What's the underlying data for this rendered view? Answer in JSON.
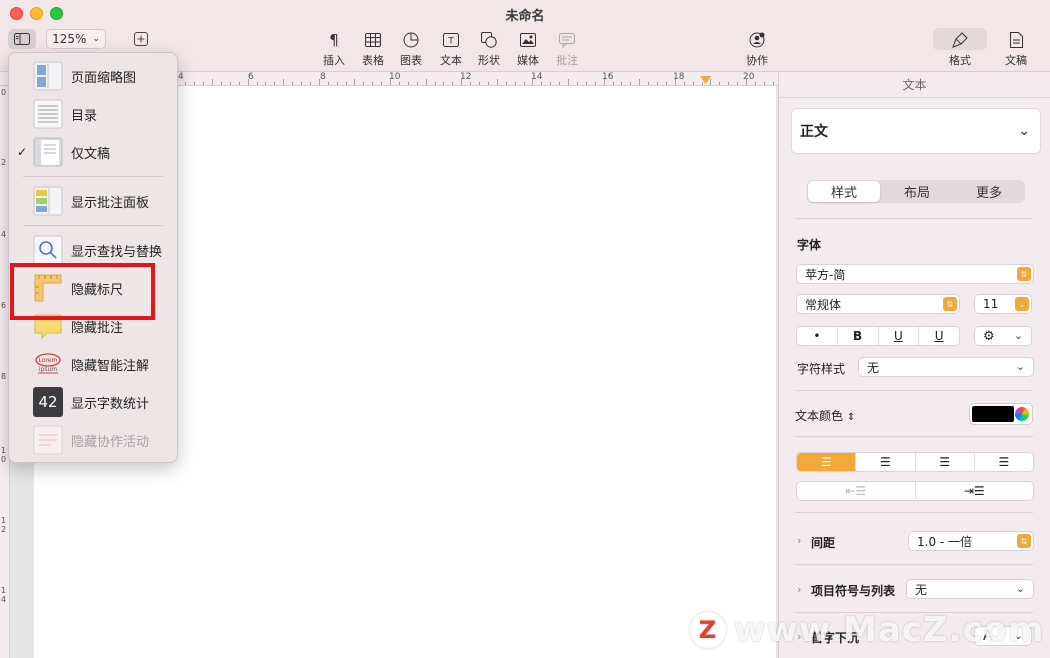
{
  "window": {
    "title": "未命名"
  },
  "toolbar": {
    "zoom": "125%",
    "tools": [
      {
        "label": "插入",
        "icon": "paragraph-icon"
      },
      {
        "label": "表格",
        "icon": "table-icon"
      },
      {
        "label": "图表",
        "icon": "chart-icon"
      },
      {
        "label": "文本",
        "icon": "textbox-icon"
      },
      {
        "label": "形状",
        "icon": "shape-icon"
      },
      {
        "label": "媒体",
        "icon": "media-icon"
      },
      {
        "label": "批注",
        "icon": "comment-icon"
      },
      {
        "label": "协作",
        "icon": "collaborate-icon"
      },
      {
        "label": "格式",
        "icon": "format-brush-icon"
      },
      {
        "label": "文稿",
        "icon": "document-icon"
      }
    ]
  },
  "ruler": {
    "numbers": [
      "4",
      "6",
      "8",
      "10",
      "12",
      "14",
      "16",
      "18",
      "20"
    ]
  },
  "vruler": {
    "numbers": [
      "0",
      "2",
      "4",
      "6",
      "8",
      "1\n0",
      "1\n2",
      "1\n4"
    ]
  },
  "menu": {
    "items": [
      {
        "label": "页面缩略图",
        "checked": false,
        "disabled": false,
        "icon": "page-thumbnails-icon"
      },
      {
        "label": "目录",
        "checked": false,
        "disabled": false,
        "icon": "table-of-contents-icon"
      },
      {
        "label": "仅文稿",
        "checked": true,
        "disabled": false,
        "icon": "document-only-icon"
      },
      {
        "label": "显示批注面板",
        "checked": false,
        "disabled": false,
        "icon": "comments-pane-icon"
      },
      {
        "label": "显示查找与替换",
        "checked": false,
        "disabled": false,
        "icon": "find-replace-icon"
      },
      {
        "label": "隐藏标尺",
        "checked": false,
        "disabled": false,
        "icon": "ruler-icon"
      },
      {
        "label": "隐藏批注",
        "checked": false,
        "disabled": false,
        "icon": "comments-icon"
      },
      {
        "label": "隐藏智能注解",
        "checked": false,
        "disabled": false,
        "icon": "smart-annotation-icon"
      },
      {
        "label": "显示字数统计",
        "checked": false,
        "disabled": false,
        "icon": "word-count-icon"
      },
      {
        "label": "隐藏协作活动",
        "checked": false,
        "disabled": true,
        "icon": "collaboration-activity-icon"
      }
    ],
    "check_mark": "✓",
    "word_count_badge": "42",
    "lorem_badge": "Lorem ipsum"
  },
  "inspector": {
    "title": "文本",
    "paragraph_style": "正文",
    "tabs": [
      "样式",
      "布局",
      "更多"
    ],
    "active_tab": "样式",
    "font_section": "字体",
    "font_family": "苹方-简",
    "font_weight": "常规体",
    "font_size": "11",
    "char_style_label": "字符样式",
    "char_style_value": "无",
    "text_color_label": "文本颜色",
    "text_color": "#000000",
    "spacing_label": "间距",
    "spacing_value": "1.0 - 一倍",
    "bullets_label": "项目符号与列表",
    "bullets_value": "无",
    "dropcap_label": "首字下沉",
    "dropcap_btn": "A"
  },
  "watermark": {
    "logo": "Z",
    "text": "www.MacZ.com"
  },
  "colors": {
    "accent": "#f2a93b",
    "highlight": "#e0171b",
    "titlebar": "#f2e6e8"
  }
}
